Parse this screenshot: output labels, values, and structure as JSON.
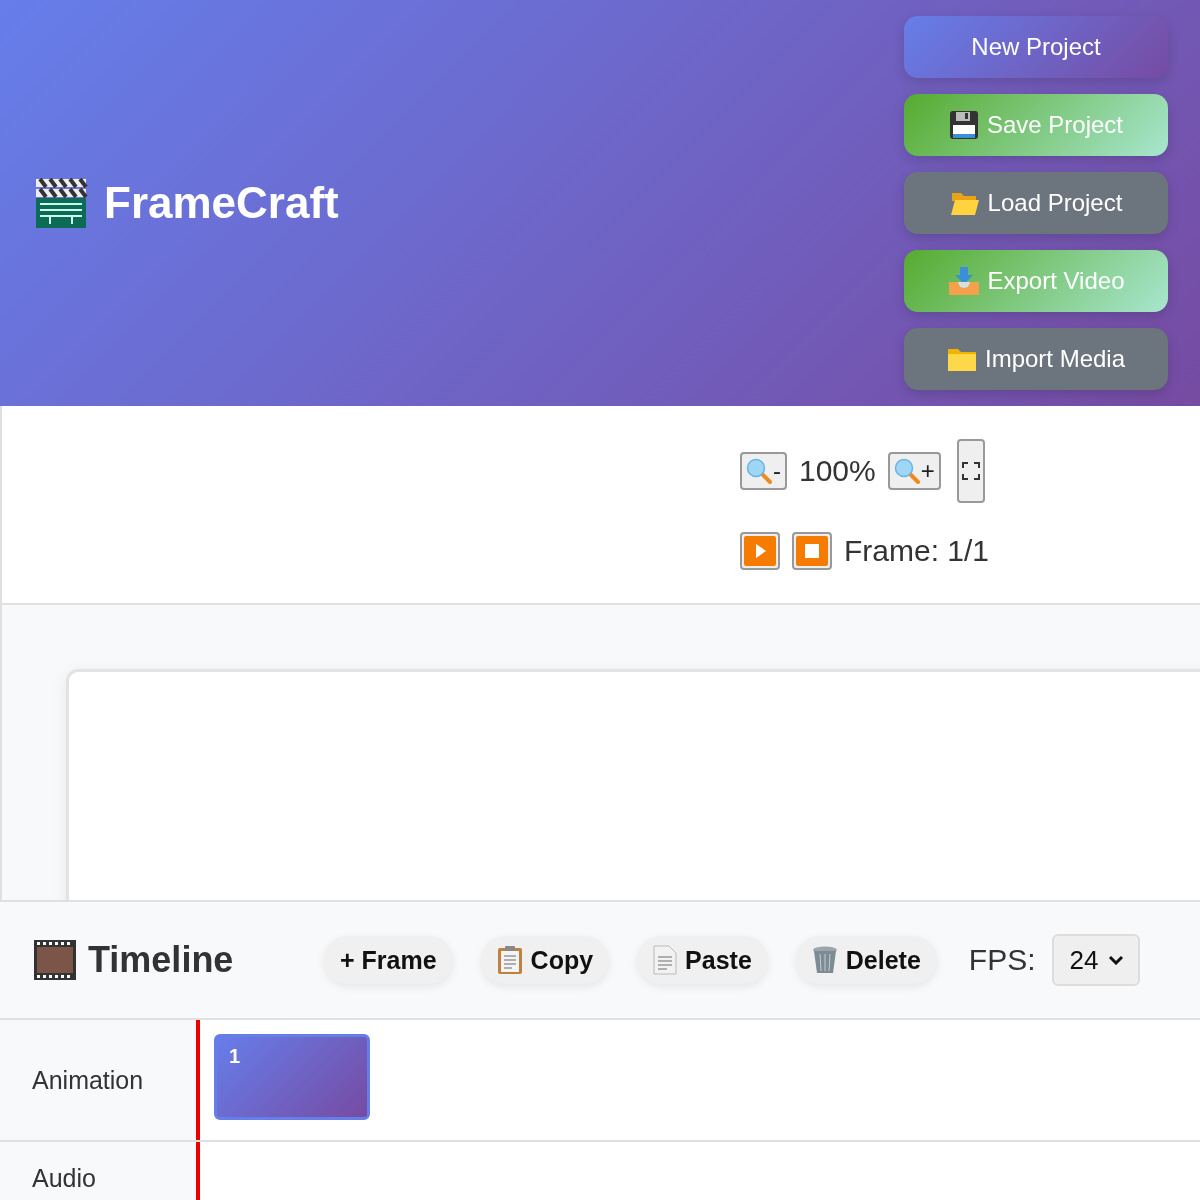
{
  "app": {
    "title": "FrameCraft"
  },
  "header_buttons": [
    {
      "label": "New Project",
      "kind": "primary"
    },
    {
      "label": "Save Project",
      "kind": "success"
    },
    {
      "label": "Load Project",
      "kind": "secondary"
    },
    {
      "label": "Export Video",
      "kind": "success"
    },
    {
      "label": "Import Media",
      "kind": "secondary"
    }
  ],
  "view_controls": {
    "zoom_out": {
      "label": "-"
    },
    "zoom_level": "100%",
    "zoom_in": {
      "label": "+"
    },
    "frame_status": "Frame: 1/1"
  },
  "timeline": {
    "title": "Timeline",
    "buttons": [
      {
        "label": "+ Frame"
      },
      {
        "label": "Copy"
      },
      {
        "label": "Paste"
      },
      {
        "label": "Delete"
      }
    ],
    "fps_label": "FPS:",
    "fps_value": "24",
    "tracks": [
      {
        "name": "Animation",
        "frames": [
          {
            "number": "1",
            "selected": true
          }
        ]
      },
      {
        "name": "Audio"
      }
    ]
  }
}
